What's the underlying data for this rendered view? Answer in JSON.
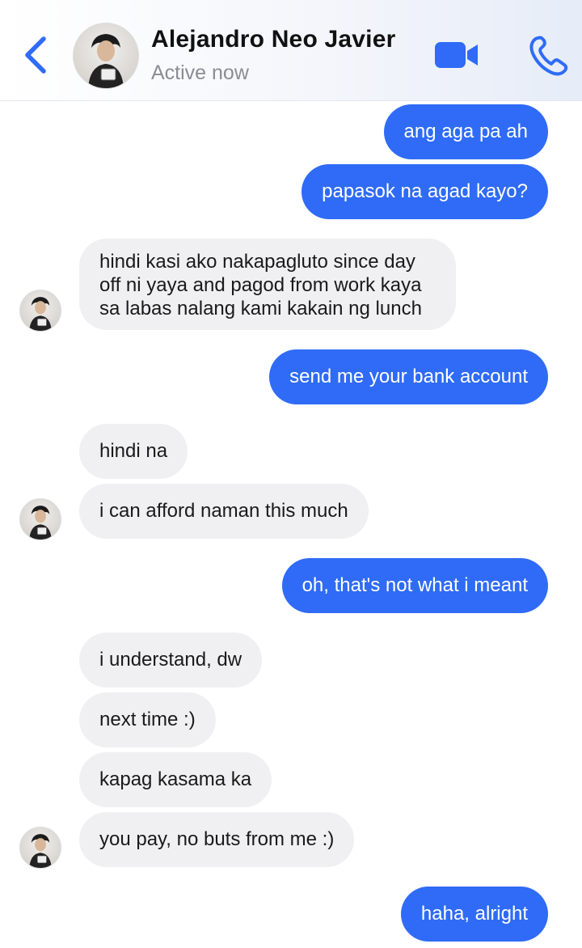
{
  "header": {
    "contact_name": "Alejandro Neo Javier",
    "status": "Active now",
    "accent_color": "#2f6bf6"
  },
  "icons": [
    "chevron-left-icon",
    "video-camera-icon",
    "phone-icon",
    "avatar"
  ],
  "messages": [
    {
      "from": "me",
      "text": "ang aga pa ah"
    },
    {
      "from": "me",
      "text": "papasok na agad kayo?"
    },
    {
      "from": "contact",
      "lines": [
        "hindi kasi ako nakapagluto since day",
        "off ni yaya and pagod from work kaya",
        "sa labas nalang kami kakain ng lunch"
      ]
    },
    {
      "from": "me",
      "text": "send me your bank account"
    },
    {
      "from": "contact",
      "text": "hindi na"
    },
    {
      "from": "contact",
      "text": "i can afford naman this much"
    },
    {
      "from": "me",
      "text": "oh, that's not what i meant"
    },
    {
      "from": "contact",
      "text": "i understand, dw"
    },
    {
      "from": "contact",
      "text": "next time :)"
    },
    {
      "from": "contact",
      "text": "kapag kasama ka"
    },
    {
      "from": "contact",
      "text": "you pay, no buts from me :)"
    },
    {
      "from": "me",
      "text": "haha, alright"
    }
  ]
}
